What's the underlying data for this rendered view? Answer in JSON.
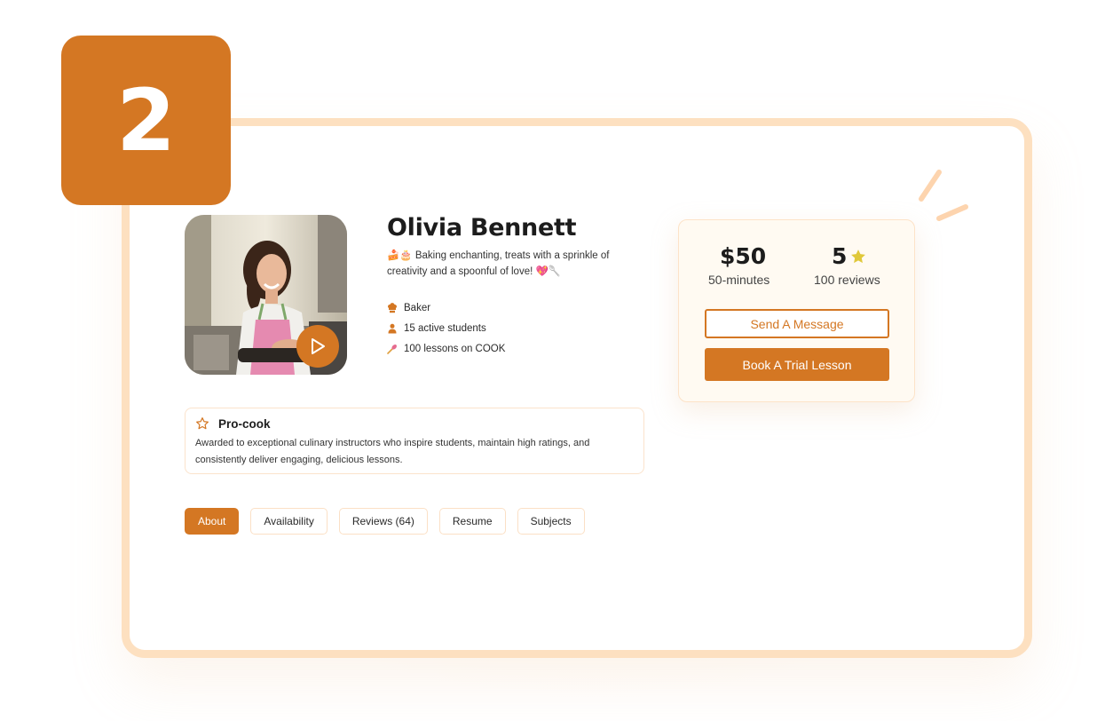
{
  "step": {
    "number": "2"
  },
  "profile": {
    "name": "Olivia Bennett",
    "bio_emoji": "🍰🎂",
    "bio": "Baking enchanting, treats with a sprinkle of creativity and a spoonful of love! 💖🥄",
    "facts": [
      {
        "icon": "chef-hat-icon",
        "text": "Baker"
      },
      {
        "icon": "user-icon",
        "text": "15 active students"
      },
      {
        "icon": "whisk-icon",
        "text": "100 lessons on COOK"
      }
    ]
  },
  "award": {
    "icon": "star-outline-icon",
    "title": "Pro-cook",
    "description": "Awarded to exceptional culinary instructors who inspire students, maintain high ratings, and consistently deliver engaging, delicious lessons."
  },
  "tabs": [
    {
      "label": "About",
      "active": true
    },
    {
      "label": "Availability",
      "active": false
    },
    {
      "label": "Reviews (64)",
      "active": false
    },
    {
      "label": "Resume",
      "active": false
    },
    {
      "label": "Subjects",
      "active": false
    }
  ],
  "pricing": {
    "price": "$50",
    "duration": "50-minutes",
    "rating": "5",
    "reviews": "100 reviews",
    "message_button": "Send A Message",
    "trial_button": "Book A Trial Lesson"
  },
  "colors": {
    "accent": "#d47723",
    "frame": "#fde0c0",
    "star": "#e0c83a",
    "card_bg": "#fffaf2"
  }
}
